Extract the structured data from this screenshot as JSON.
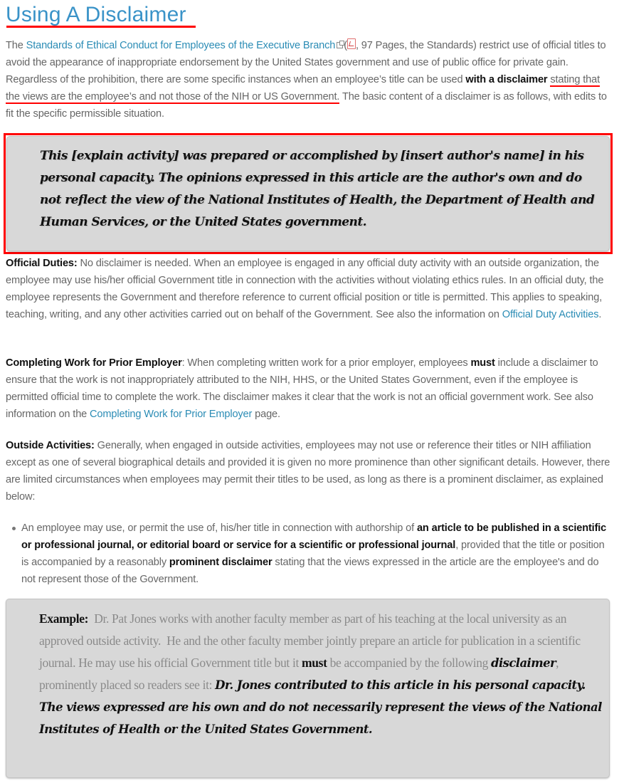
{
  "page": {
    "title": "Using A Disclaimer"
  },
  "intro": {
    "prefix": "The ",
    "standards_link": "Standards of Ethical Conduct for Employees of the Executive Branch",
    "external_link_icon": "external-link-icon",
    "pdf_icon": "pdf-icon",
    "after_icons": "(",
    "pdf_meta": ", 97 Pages, the Standards) restrict use of official titles to avoid the appearance of inappropriate endorsement by the United States government and use of public office for private gain.  Regardless of the prohibition, there are some specific instances when an employee’s title can be used ",
    "bold_phrase": "with a disclaimer",
    "space": " ",
    "underlined_phrase": "stating that the views are the employee’s and not those of the NIH or US Government.",
    "suffix": " The basic content of a disclaimer is as follows, with edits to fit the specific permissible situation."
  },
  "disclaimer_box": {
    "text": "This [explain activity] was prepared or accomplished by [insert author's name] in his personal capacity. The opinions expressed in this article are the author's own and do not reflect the view of the National Institutes of Health, the Department of Health and Human Services, or the United States government."
  },
  "official_duties": {
    "label": "Official Duties:",
    "body": " No disclaimer is needed. When an employee is engaged in any official duty activity with an outside organization, the employee may use his/her official Government title in connection with the activities without violating ethics rules.  In an official duty, the employee represents the Government and therefore reference to current official position or title is permitted.  This applies to speaking, teaching, writing, and any other activities carried out on behalf of the Government.  See also the information on ",
    "link": "Official Duty Activities",
    "end": "."
  },
  "prior_employer": {
    "label": "Completing Work for Prior Employer",
    "body1": ": When completing written work for a prior employer, employees ",
    "must": "must",
    "body2": " include a disclaimer to ensure that the work is not inappropriately attributed to the NIH, HHS, or the United States Government, even if the employee is permitted official time to complete the work. The disclaimer makes it clear that the work is not an official government work. See also information on the ",
    "link": "Completing Work for Prior Employer",
    "end": " page."
  },
  "outside_activities": {
    "label": "Outside Activities:",
    "body": " Generally, when engaged in outside activities, employees may not use or reference their titles or NIH affiliation except as one of several biographical details and provided it is given no more prominence than other significant details. However, there are limited circumstances when employees may permit their titles to be used, as long as there is a prominent disclaimer, as explained below:"
  },
  "bullets": [
    {
      "text1": "An employee may use, or permit the use of, his/her title in connection with authorship of ",
      "bold1": "an article to be published in a scientific or professional journal, or editorial board or service for a scientific or professional journal",
      "text2": ", provided that the title or position is accompanied by a reasonably ",
      "bold2": "prominent disclaimer",
      "text3": " stating that the views expressed in the article are the employee's and do not represent those of the Government."
    }
  ],
  "example_box": {
    "label": "Example:",
    "text1": "  Dr. Pat Jones works with another faculty member as part of his teaching at the local university as an approved outside activity.  He and the other faculty member jointly prepare an article for publication in a scientific journal. He may use his official Government title but it ",
    "must": "must",
    "text2": " be accompanied by the following ",
    "disclaimer_word": "disclaimer",
    "text3": ", prominently placed so readers see it: ",
    "quote": "Dr. Jones contributed to this article in his personal capacity. The views expressed are his own and do not necessarily represent the views of the National Institutes of Health or the United States Government."
  },
  "colors": {
    "title": "#3a93c8",
    "link": "#2b8cb5",
    "highlight_red": "#ff0000",
    "box_gray": "#d8d8d8",
    "body_text": "#666666"
  }
}
